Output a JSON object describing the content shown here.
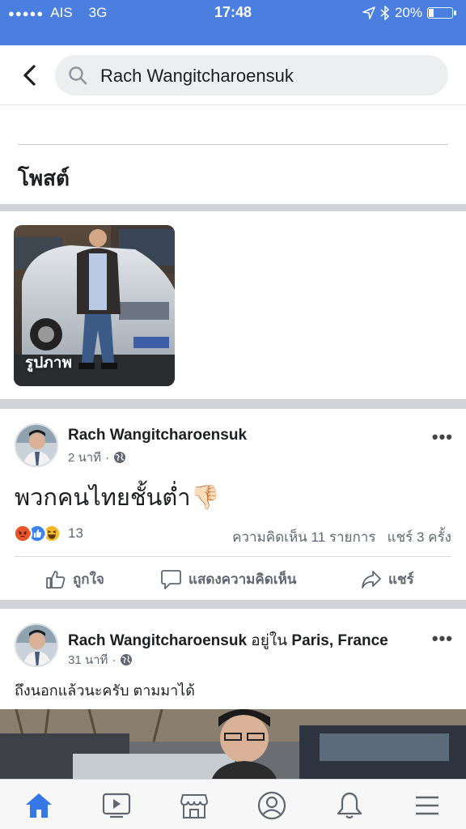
{
  "status_bar": {
    "signal": "●●●●●",
    "carrier": "AIS",
    "network": "3G",
    "time": "17:48",
    "battery_text": "20%",
    "battery_level": 0.2
  },
  "search": {
    "query": "Rach Wangitcharoensuk"
  },
  "posts_section": {
    "title": "โพสต์"
  },
  "photo_tile": {
    "label": "รูปภาพ"
  },
  "post1": {
    "author": "Rach Wangitcharoensuk",
    "time": "2 นาที",
    "separator": "·",
    "text": "พวกคนไทยชั้นต่ำ👎🏻",
    "reaction_count": "13",
    "comments": "ความคิดเห็น 11 รายการ",
    "shares": "แชร์ 3 ครั้ง",
    "like_label": "ถูกใจ",
    "comment_label": "แสดงความคิดเห็น",
    "share_label": "แชร์"
  },
  "post2": {
    "author": "Rach Wangitcharoensuk",
    "location_prefix": "อยู่ใน",
    "location": "Paris, France",
    "time": "31 นาที",
    "separator": "·",
    "text": "ถึงนอกแล้วนะครับ ตามมาได้"
  },
  "colors": {
    "status_bar": "#4a7fe0",
    "accent": "#3578e5",
    "angry": "#e8572a",
    "like": "#3b82f0",
    "haha": "#f7b928"
  },
  "bottom_nav": [
    "home-icon",
    "video-icon",
    "marketplace-icon",
    "profile-icon",
    "notifications-icon",
    "menu-icon"
  ]
}
